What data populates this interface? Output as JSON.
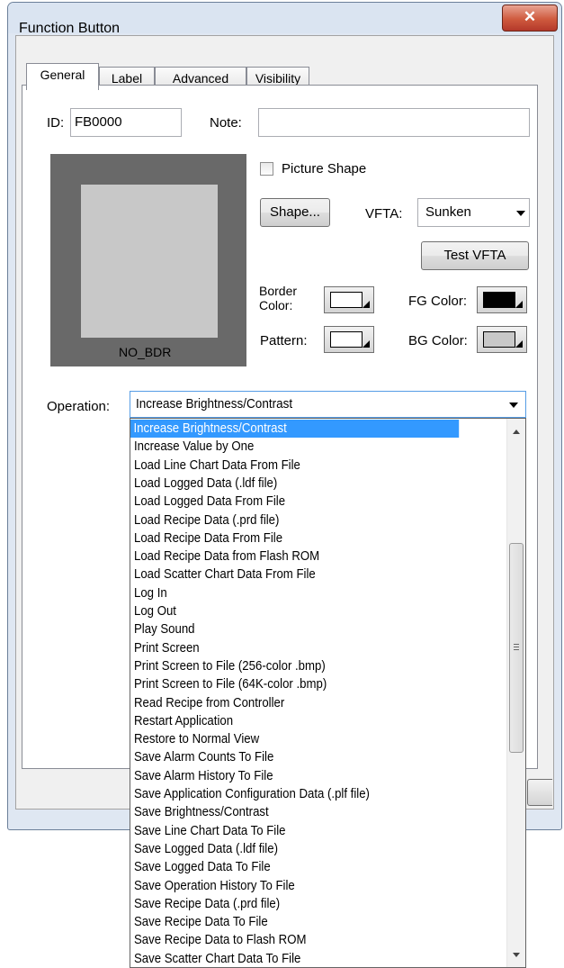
{
  "window": {
    "title": "Function Button",
    "close_glyph": "✕"
  },
  "tabs": [
    {
      "label": "General",
      "active": true
    },
    {
      "label": "Label",
      "active": false
    },
    {
      "label": "Advanced",
      "active": false
    },
    {
      "label": "Visibility",
      "active": false
    }
  ],
  "general": {
    "id_label": "ID:",
    "id_value": "FB0000",
    "note_label": "Note:",
    "note_value": "",
    "preview_text": "NO_BDR",
    "picture_shape_label": "Picture Shape",
    "picture_shape_checked": false,
    "shape_button": "Shape...",
    "vfta_label": "VFTA:",
    "vfta_value": "Sunken",
    "test_vfta_button": "Test VFTA",
    "border_color_label_1": "Border",
    "border_color_label_2": "Color:",
    "fg_color_label": "FG Color:",
    "pattern_label": "Pattern:",
    "bg_color_label": "BG Color:",
    "colors": {
      "border": "#ffffff",
      "fg": "#000000",
      "pattern": "#ffffff",
      "bg": "#c8c8c8",
      "preview_outer": "#696969",
      "preview_inner": "#c8c8c8",
      "selection": "#3399ff"
    },
    "operation_label": "Operation:",
    "operation_value": "Increase Brightness/Contrast"
  },
  "operation_options": [
    "Increase Brightness/Contrast",
    "Increase Value by One",
    "Load Line Chart Data From File",
    "Load Logged Data (.ldf file)",
    "Load Logged Data From File",
    "Load Recipe Data (.prd file)",
    "Load Recipe Data From File",
    "Load Recipe Data from Flash ROM",
    "Load Scatter Chart Data From File",
    "Log In",
    "Log Out",
    "Play Sound",
    "Print Screen",
    "Print Screen to File (256-color .bmp)",
    "Print Screen to File (64K-color .bmp)",
    "Read Recipe from Controller",
    "Restart Application",
    "Restore to Normal View",
    "Save Alarm Counts To File",
    "Save Alarm History To File",
    "Save Application Configuration Data (.plf file)",
    "Save Brightness/Contrast",
    "Save Line Chart Data To File",
    "Save Logged Data (.ldf file)",
    "Save Logged Data To File",
    "Save Operation History To File",
    "Save Recipe Data (.prd file)",
    "Save Recipe Data To File",
    "Save Recipe Data to Flash ROM",
    "Save Scatter Chart Data To File"
  ],
  "selected_option_index": 0
}
